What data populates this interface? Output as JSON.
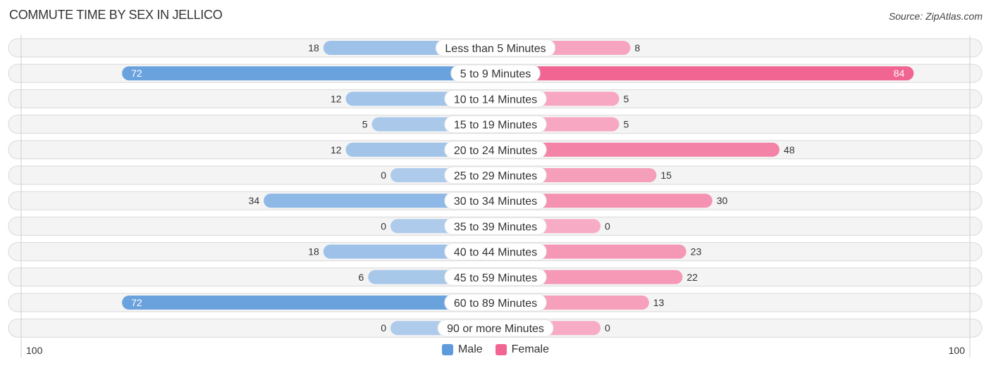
{
  "header": {
    "title": "COMMUTE TIME BY SEX IN JELLICO",
    "source": "Source: ZipAtlas.com"
  },
  "legend": {
    "male_label": "Male",
    "female_label": "Female"
  },
  "colors": {
    "male_strong": "#5f9bdc",
    "male_light": "#aecbeb",
    "female_strong": "#f06592",
    "female_light": "#f7abc4"
  },
  "chart_data": {
    "type": "bar",
    "orientation": "horizontal-diverging",
    "title": "COMMUTE TIME BY SEX IN JELLICO",
    "categories": [
      "Less than 5 Minutes",
      "5 to 9 Minutes",
      "10 to 14 Minutes",
      "15 to 19 Minutes",
      "20 to 24 Minutes",
      "25 to 29 Minutes",
      "30 to 34 Minutes",
      "35 to 39 Minutes",
      "40 to 44 Minutes",
      "45 to 59 Minutes",
      "60 to 89 Minutes",
      "90 or more Minutes"
    ],
    "series": [
      {
        "name": "Male",
        "values": [
          18,
          72,
          12,
          5,
          12,
          0,
          34,
          0,
          18,
          6,
          72,
          0
        ]
      },
      {
        "name": "Female",
        "values": [
          8,
          84,
          5,
          5,
          48,
          15,
          30,
          0,
          23,
          22,
          13,
          0
        ]
      }
    ],
    "axis": {
      "left_label": "100",
      "right_label": "100",
      "range": [
        -100,
        100
      ]
    },
    "legend_position": "bottom-center",
    "grid": false
  }
}
